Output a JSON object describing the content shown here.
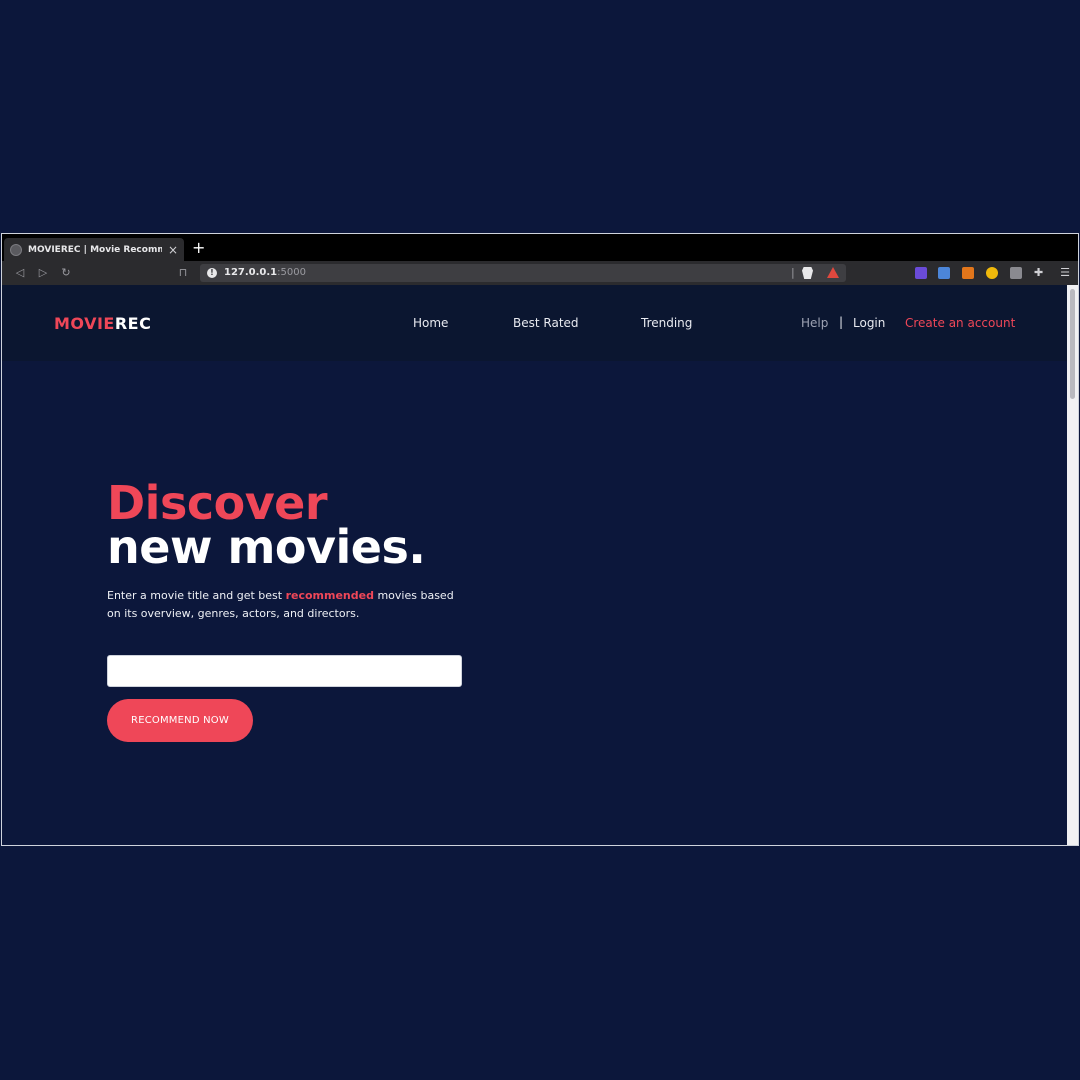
{
  "browser": {
    "tab_title": "MOVIEREC | Movie Recommend",
    "tab_close": "×",
    "new_tab": "+",
    "url_host": "127.0.0.1",
    "url_port": ":5000"
  },
  "site": {
    "logo_part1": "MOVIE",
    "logo_part2": "REC",
    "nav": {
      "home": "Home",
      "best_rated": "Best Rated",
      "trending": "Trending"
    },
    "account": {
      "help": "Help",
      "separator": "|",
      "login": "Login",
      "create": "Create an account"
    }
  },
  "hero": {
    "title_line1": "Discover",
    "title_line2": "new movies.",
    "desc_before": "Enter a movie title and get best ",
    "desc_highlight": "recommended",
    "desc_after": " movies based on its overview, genres, actors, and directors.",
    "search_value": "",
    "button_label": "RECOMMEND NOW"
  },
  "colors": {
    "background": "#0c173b",
    "navbar": "#0b1630",
    "accent": "#ef4758"
  },
  "icons": [
    "back-icon",
    "forward-icon",
    "reload-icon",
    "bookmark-icon",
    "site-info-icon",
    "brave-shield-icon",
    "brave-rewards-icon",
    "extension-icons",
    "puzzle-icon",
    "menu-icon"
  ]
}
